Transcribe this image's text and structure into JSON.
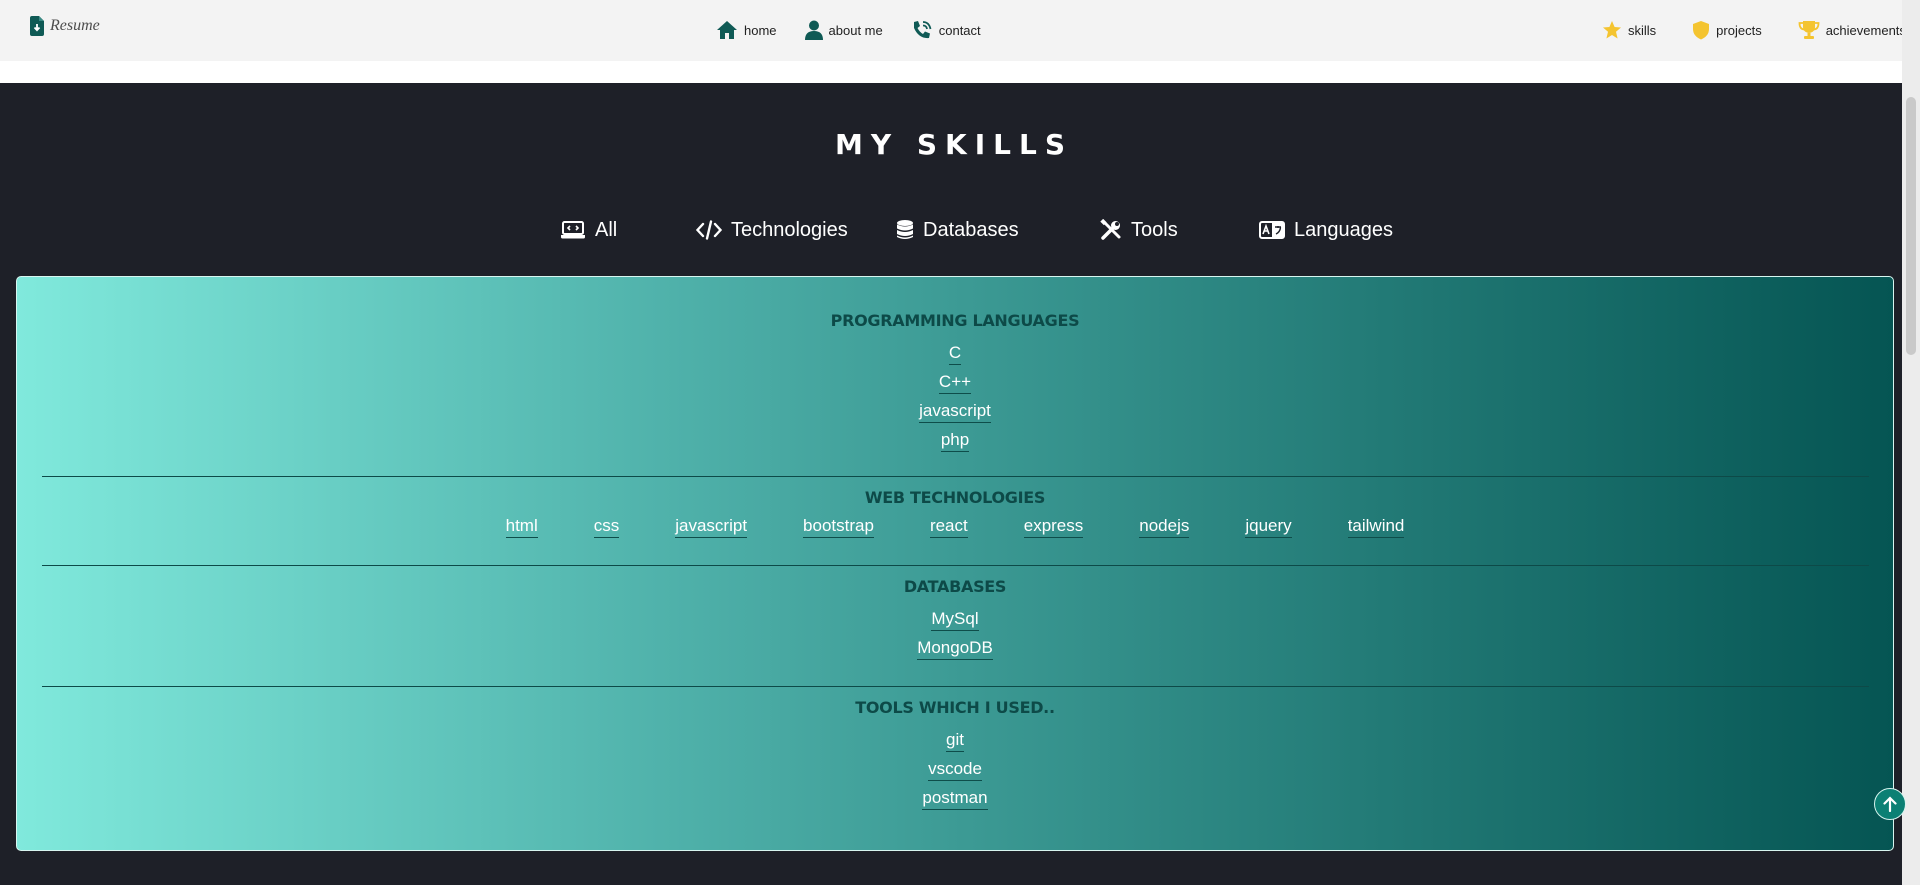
{
  "navbar": {
    "brand_label": "Resume",
    "center_links": [
      {
        "label": "home",
        "icon": "home-icon"
      },
      {
        "label": "about me",
        "icon": "user-icon"
      },
      {
        "label": "contact",
        "icon": "phone-icon"
      }
    ],
    "right_links": [
      {
        "label": "skills",
        "icon": "star-icon"
      },
      {
        "label": "projects",
        "icon": "shield-icon"
      },
      {
        "label": "achievements",
        "icon": "trophy-icon"
      }
    ]
  },
  "skills": {
    "title": "MY SKILLS",
    "tabs": [
      {
        "label": "All",
        "icon": "laptop-code-icon"
      },
      {
        "label": "Technologies",
        "icon": "code-icon"
      },
      {
        "label": "Databases",
        "icon": "database-icon"
      },
      {
        "label": "Tools",
        "icon": "tools-icon"
      },
      {
        "label": "Languages",
        "icon": "language-icon"
      }
    ],
    "groups": [
      {
        "title": "PROGRAMMING LANGUAGES",
        "items": [
          "C",
          "C++",
          "javascript",
          "php"
        ]
      },
      {
        "title": "WEB TECHNOLOGIES",
        "items": [
          "html",
          "css",
          "javascript",
          "bootstrap",
          "react",
          "express",
          "nodejs",
          "jquery",
          "tailwind"
        ]
      },
      {
        "title": "DATABASES",
        "items": [
          "MySql",
          "MongoDB"
        ]
      },
      {
        "title": "TOOLS WHICH I USED..",
        "items": [
          "git",
          "vscode",
          "postman"
        ]
      }
    ]
  },
  "colors": {
    "nav_icon": "#0f5a55",
    "accent_yellow": "#f4c430",
    "dark_bg": "#1e2028",
    "gradient_start": "#80e9dc",
    "gradient_end": "#055553",
    "group_title": "#0d4a48"
  },
  "back_to_top_icon": "arrow-up-icon"
}
